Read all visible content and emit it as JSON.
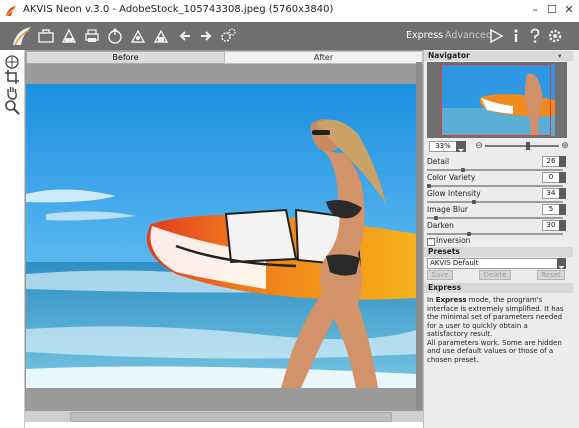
{
  "window": {
    "title": "AKVIS Neon v.3.0 - AdobeStock_105743308.jpeg (5760x3840)",
    "minimize": "–",
    "maximize": "☐",
    "close": "✕"
  },
  "toolbar": {
    "icons": [
      "logo-icon",
      "open-icon",
      "save-icon",
      "print-icon",
      "share-icon",
      "batch-icon",
      "export-icon",
      "undo-icon",
      "redo-icon",
      "settings-gears-icon"
    ],
    "mode_express": "Express",
    "mode_advanced": "Advanced",
    "right_icons": [
      "run-icon",
      "info-icon",
      "help-icon",
      "preferences-icon"
    ]
  },
  "tools": [
    "navigation-icon",
    "crop-icon",
    "hand-icon",
    "zoom-icon"
  ],
  "canvas": {
    "tab_before": "Before",
    "tab_after": "After"
  },
  "navigator": {
    "title": "Navigator",
    "zoom": "33%"
  },
  "params": [
    {
      "label": "Detail",
      "value": "26",
      "level": 0.26
    },
    {
      "label": "Color Variety",
      "value": "0",
      "level": 0.0
    },
    {
      "label": "Glow Intensity",
      "value": "34",
      "level": 0.34
    },
    {
      "label": "Image Blur",
      "value": "5",
      "level": 0.05
    },
    {
      "label": "Darken",
      "value": "30",
      "level": 0.3
    }
  ],
  "inversion_label": "Inversion",
  "presets": {
    "title": "Presets",
    "selected": "AKVIS Default",
    "save": "Save",
    "delete": "Delete",
    "reset": "Reset"
  },
  "help": {
    "title": "Express",
    "p1_pre": "In ",
    "p1_bold": "Express",
    "p1_post": " mode, the program's interface is extremely simplified. It has the minimal set of parameters needed for a user to quickly obtain a satisfactory result.",
    "p2": "All parameters work. Some are hidden and use default values or those of a chosen preset."
  },
  "colors": {
    "toolbar_bg": "#6f6f6f",
    "panel_bg": "#ececec",
    "accent_red": "#e23b3b"
  }
}
